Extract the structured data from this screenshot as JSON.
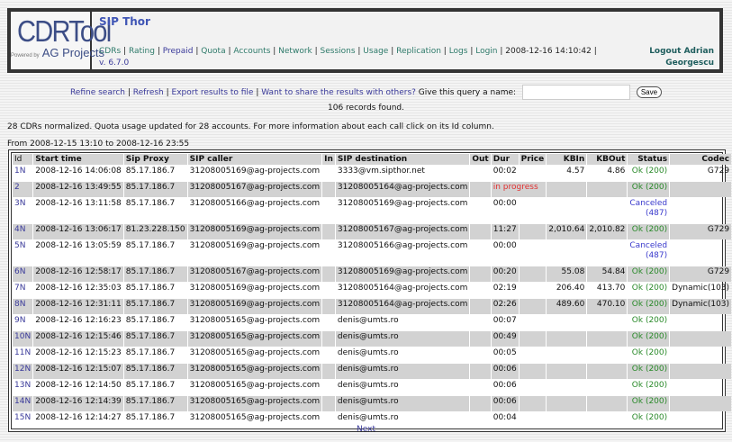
{
  "header": {
    "logo_text": "CDRTool",
    "logo_powered": "Powered by",
    "logo_company": "AG Projects",
    "title": "SIP Thor",
    "nav": [
      "CDRs",
      "Rating",
      "Prepaid",
      "Quota",
      "Accounts",
      "Network",
      "Sessions",
      "Usage",
      "Replication",
      "Logs",
      "Login"
    ],
    "datetime": "2008-12-16 14:10:42",
    "version": "v. 6.7.0",
    "logout": "Logout Adrian Georgescu"
  },
  "actions": {
    "refine": "Refine search",
    "refresh": "Refresh",
    "export": "Export results to file",
    "share": "Want to share the results with others?",
    "name_label": "Give this query a name:",
    "name_value": "",
    "save": "Save"
  },
  "records_found": "106 records found.",
  "message": "28 CDRs normalized. Quota usage updated for 28 accounts. For more information about each call click on its Id column.",
  "range": "From 2008-12-15 13:10 to 2008-12-16 23:55",
  "table": {
    "columns": [
      "Id",
      "Start time",
      "Sip Proxy",
      "SIP caller",
      "In",
      "SIP destination",
      "Out",
      "Dur",
      "Price",
      "KBIn",
      "KBOut",
      "Status",
      "Codec"
    ],
    "rows": [
      {
        "id": "1N",
        "start": "2008-12-16 14:06:08",
        "proxy": "85.17.186.7",
        "caller": "31208005169@ag-projects.com",
        "in": "",
        "dest": "3333@vm.sipthor.net",
        "out": "",
        "dur": "00:02",
        "price": "",
        "kbin": "4.57",
        "kbout": "4.86",
        "status": "Ok (200)",
        "codec": "G729"
      },
      {
        "id": "2",
        "start": "2008-12-16 13:49:55",
        "proxy": "85.17.186.7",
        "caller": "31208005167@ag-projects.com",
        "in": "",
        "dest": "31208005164@ag-projects.com",
        "out": "",
        "dur": "in progress",
        "price": "",
        "kbin": "",
        "kbout": "",
        "status": "Ok (200)",
        "codec": ""
      },
      {
        "id": "3N",
        "start": "2008-12-16 13:11:58",
        "proxy": "85.17.186.7",
        "caller": "31208005166@ag-projects.com",
        "in": "",
        "dest": "31208005169@ag-projects.com",
        "out": "",
        "dur": "00:00",
        "price": "",
        "kbin": "",
        "kbout": "",
        "status": "Canceled (487)",
        "codec": ""
      },
      {
        "id": "4N",
        "start": "2008-12-16 13:06:17",
        "proxy": "81.23.228.150",
        "caller": "31208005169@ag-projects.com",
        "in": "",
        "dest": "31208005167@ag-projects.com",
        "out": "",
        "dur": "11:27",
        "price": "",
        "kbin": "2,010.64",
        "kbout": "2,010.82",
        "status": "Ok (200)",
        "codec": "G729"
      },
      {
        "id": "5N",
        "start": "2008-12-16 13:05:59",
        "proxy": "85.17.186.7",
        "caller": "31208005169@ag-projects.com",
        "in": "",
        "dest": "31208005166@ag-projects.com",
        "out": "",
        "dur": "00:00",
        "price": "",
        "kbin": "",
        "kbout": "",
        "status": "Canceled (487)",
        "codec": ""
      },
      {
        "id": "6N",
        "start": "2008-12-16 12:58:17",
        "proxy": "85.17.186.7",
        "caller": "31208005167@ag-projects.com",
        "in": "",
        "dest": "31208005169@ag-projects.com",
        "out": "",
        "dur": "00:20",
        "price": "",
        "kbin": "55.08",
        "kbout": "54.84",
        "status": "Ok (200)",
        "codec": "G729"
      },
      {
        "id": "7N",
        "start": "2008-12-16 12:35:03",
        "proxy": "85.17.186.7",
        "caller": "31208005169@ag-projects.com",
        "in": "",
        "dest": "31208005164@ag-projects.com",
        "out": "",
        "dur": "02:19",
        "price": "",
        "kbin": "206.40",
        "kbout": "413.70",
        "status": "Ok (200)",
        "codec": "Dynamic(103)"
      },
      {
        "id": "8N",
        "start": "2008-12-16 12:31:11",
        "proxy": "85.17.186.7",
        "caller": "31208005169@ag-projects.com",
        "in": "",
        "dest": "31208005164@ag-projects.com",
        "out": "",
        "dur": "02:26",
        "price": "",
        "kbin": "489.60",
        "kbout": "470.10",
        "status": "Ok (200)",
        "codec": "Dynamic(103)"
      },
      {
        "id": "9N",
        "start": "2008-12-16 12:16:23",
        "proxy": "85.17.186.7",
        "caller": "31208005165@ag-projects.com",
        "in": "",
        "dest": "denis@umts.ro",
        "out": "",
        "dur": "00:07",
        "price": "",
        "kbin": "",
        "kbout": "",
        "status": "Ok (200)",
        "codec": ""
      },
      {
        "id": "10N",
        "start": "2008-12-16 12:15:46",
        "proxy": "85.17.186.7",
        "caller": "31208005165@ag-projects.com",
        "in": "",
        "dest": "denis@umts.ro",
        "out": "",
        "dur": "00:49",
        "price": "",
        "kbin": "",
        "kbout": "",
        "status": "Ok (200)",
        "codec": ""
      },
      {
        "id": "11N",
        "start": "2008-12-16 12:15:23",
        "proxy": "85.17.186.7",
        "caller": "31208005165@ag-projects.com",
        "in": "",
        "dest": "denis@umts.ro",
        "out": "",
        "dur": "00:05",
        "price": "",
        "kbin": "",
        "kbout": "",
        "status": "Ok (200)",
        "codec": ""
      },
      {
        "id": "12N",
        "start": "2008-12-16 12:15:07",
        "proxy": "85.17.186.7",
        "caller": "31208005165@ag-projects.com",
        "in": "",
        "dest": "denis@umts.ro",
        "out": "",
        "dur": "00:06",
        "price": "",
        "kbin": "",
        "kbout": "",
        "status": "Ok (200)",
        "codec": ""
      },
      {
        "id": "13N",
        "start": "2008-12-16 12:14:50",
        "proxy": "85.17.186.7",
        "caller": "31208005165@ag-projects.com",
        "in": "",
        "dest": "denis@umts.ro",
        "out": "",
        "dur": "00:06",
        "price": "",
        "kbin": "",
        "kbout": "",
        "status": "Ok (200)",
        "codec": ""
      },
      {
        "id": "14N",
        "start": "2008-12-16 12:14:39",
        "proxy": "85.17.186.7",
        "caller": "31208005165@ag-projects.com",
        "in": "",
        "dest": "denis@umts.ro",
        "out": "",
        "dur": "00:06",
        "price": "",
        "kbin": "",
        "kbout": "",
        "status": "Ok (200)",
        "codec": ""
      },
      {
        "id": "15N",
        "start": "2008-12-16 12:14:27",
        "proxy": "85.17.186.7",
        "caller": "31208005165@ag-projects.com",
        "in": "",
        "dest": "denis@umts.ro",
        "out": "",
        "dur": "00:04",
        "price": "",
        "kbin": "",
        "kbout": "",
        "status": "Ok (200)",
        "codec": ""
      }
    ]
  },
  "pagination": {
    "next": "Next"
  }
}
